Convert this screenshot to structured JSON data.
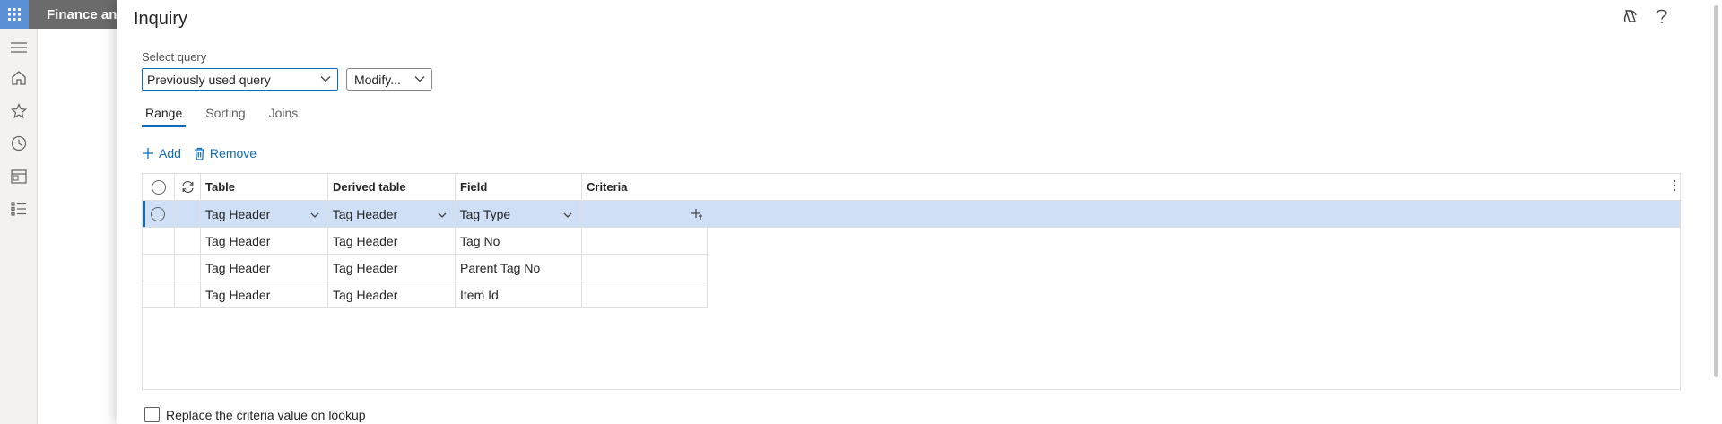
{
  "app": {
    "title": "Finance and"
  },
  "dialog": {
    "title": "Inquiry",
    "select_query_label": "Select query",
    "query_value": "Previously used query",
    "modify_label": "Modify...",
    "tabs": [
      {
        "label": "Range",
        "active": true
      },
      {
        "label": "Sorting",
        "active": false
      },
      {
        "label": "Joins",
        "active": false
      }
    ],
    "actions": {
      "add": "Add",
      "remove": "Remove"
    },
    "grid": {
      "headers": {
        "table": "Table",
        "derived": "Derived table",
        "field": "Field",
        "criteria": "Criteria"
      },
      "rows": [
        {
          "table": "Tag Header",
          "derived": "Tag Header",
          "field": "Tag Type",
          "criteria": ""
        },
        {
          "table": "Tag Header",
          "derived": "Tag Header",
          "field": "Tag No",
          "criteria": ""
        },
        {
          "table": "Tag Header",
          "derived": "Tag Header",
          "field": "Parent Tag No",
          "criteria": ""
        },
        {
          "table": "Tag Header",
          "derived": "Tag Header",
          "field": "Item Id",
          "criteria": ""
        }
      ]
    },
    "replace_label": "Replace the criteria value on lookup"
  },
  "colors": {
    "accent": "#0f6cbd",
    "selected_row": "#cfe0f6",
    "appbar": "#6b6b6b"
  }
}
